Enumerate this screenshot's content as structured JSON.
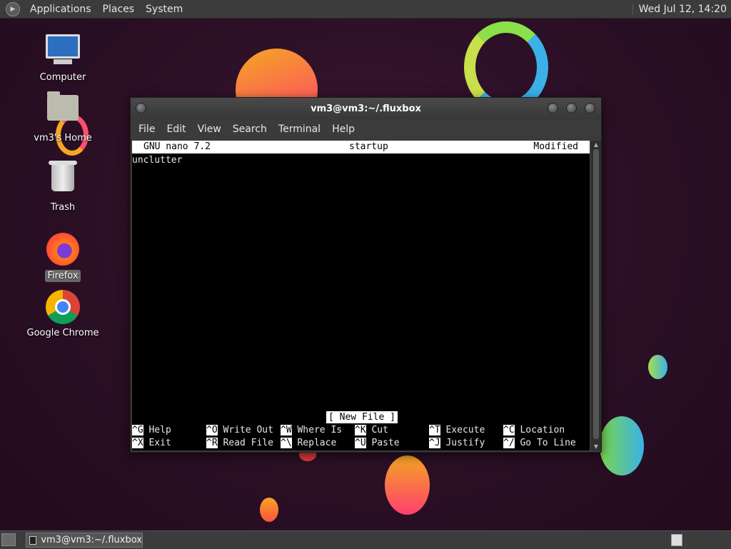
{
  "top_panel": {
    "menus": [
      "Applications",
      "Places",
      "System"
    ],
    "clock": "Wed Jul 12, 14:20"
  },
  "desktop": {
    "icons": [
      {
        "label": "Computer",
        "icon": "computer-icon"
      },
      {
        "label": "vm3's Home",
        "icon": "home-folder-icon"
      },
      {
        "label": "Trash",
        "icon": "trash-icon"
      },
      {
        "label": "Firefox",
        "icon": "firefox-icon",
        "selected": true
      },
      {
        "label": "Google Chrome",
        "icon": "chrome-icon"
      }
    ]
  },
  "window": {
    "title": "vm3@vm3:~/.fluxbox",
    "menus": [
      "File",
      "Edit",
      "View",
      "Search",
      "Terminal",
      "Help"
    ]
  },
  "nano": {
    "version": "GNU nano 7.2",
    "filename": "startup",
    "state": "Modified",
    "content_line": "unclutter",
    "status": "[ New File ]",
    "shortcuts_row1": [
      {
        "key": "^G",
        "label": "Help"
      },
      {
        "key": "^O",
        "label": "Write Out"
      },
      {
        "key": "^W",
        "label": "Where Is"
      },
      {
        "key": "^K",
        "label": "Cut"
      },
      {
        "key": "^T",
        "label": "Execute"
      },
      {
        "key": "^C",
        "label": "Location"
      }
    ],
    "shortcuts_row2": [
      {
        "key": "^X",
        "label": "Exit"
      },
      {
        "key": "^R",
        "label": "Read File"
      },
      {
        "key": "^\\",
        "label": "Replace"
      },
      {
        "key": "^U",
        "label": "Paste"
      },
      {
        "key": "^J",
        "label": "Justify"
      },
      {
        "key": "^/",
        "label": "Go To Line"
      }
    ]
  },
  "taskbar": {
    "task_label": "vm3@vm3:~/.fluxbox"
  }
}
